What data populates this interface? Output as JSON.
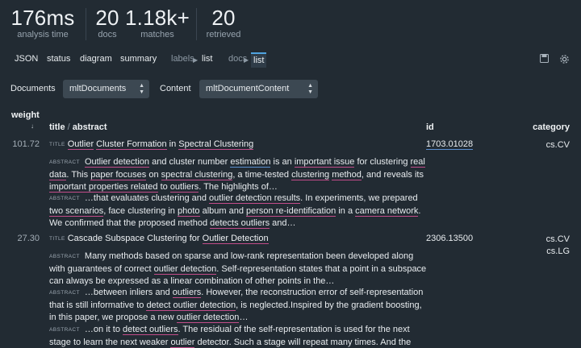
{
  "stats": [
    {
      "value": "176ms",
      "label": "analysis time"
    },
    {
      "value": "20",
      "label": "docs"
    },
    {
      "value": "1.18k+",
      "label": "matches"
    },
    {
      "value": "20",
      "label": "retrieved"
    }
  ],
  "nav": {
    "json": "JSON",
    "status": "status",
    "diagram": "diagram",
    "summary": "summary",
    "labels": "labels",
    "labels_list": "list",
    "docs": "docs",
    "docs_list": "list"
  },
  "toolbar": {
    "documents_label": "Documents",
    "documents_value": "mltDocuments",
    "content_label": "Content",
    "content_value": "mltDocumentContent"
  },
  "table": {
    "headers": {
      "weight": "weight",
      "title": "title",
      "sep": "/",
      "abstract": "abstract",
      "id": "id",
      "category": "category"
    },
    "rows": [
      {
        "weight": "101.72",
        "title_tag": "TITLE",
        "title_parts": [
          "Outlier",
          " ",
          "Cluster Formation",
          " in ",
          "Spectral Clustering"
        ],
        "id": "1703.01028",
        "categories": [
          "cs.CV"
        ],
        "abstract_tag": "ABSTRACT",
        "abstract_html": [
          "<span class='tag'>ABSTRACT</span> <u-p>Outlier detection</u-p> and cluster number <u-b>estimation</u-b> is an <u-p>important issue</u-p> for clustering <u-p>real data</u-p>. This <u-p>paper focuses</u-p> on <u-p>spectral clustering</u-p>, a time-tested <u-p>clustering</u-p> <u-p>method</u-p>, and reveals its <u-p>important properties related</u-p> to <u-p>outliers</u-p>. The highlights of…",
          "<span class='tag'>ABSTRACT</span> …that evaluates clustering and <u-p>outlier detection results</u-p>. In experiments, we prepared <u-p>two scenarios</u-p>, face clustering in <u-p>photo</u-p> album and <u-p>person re-identification</u-p> in a <u-p>camera network</u-p>. We confirmed that the proposed method <u-p>detects outliers</u-p> and…"
        ]
      },
      {
        "weight": "27.30",
        "title_tag": "TITLE",
        "title_parts": [
          "Cascade Subspace Clustering for ",
          "Outlier Detection"
        ],
        "id": "2306.13500",
        "categories": [
          "cs.CV",
          "cs.LG"
        ],
        "abstract_tag": "ABSTRACT",
        "abstract_html": [
          "<span class='tag'>ABSTRACT</span> Many methods based on sparse and low-rank representation been developed along with guarantees of correct <u-p>outlier detection</u-p>. Self-representation states that a point in a subspace can always be expressed as a linear combination of other points in the…",
          "<span class='tag'>ABSTRACT</span> …between inliers and <u-p>outliers</u-p>. However, the reconstruction error of self-representation that is still informative to <u-p>detect outlier detection</u-p>, is neglected.Inspired by the gradient boosting, in this paper, we propose a new <u-p>outlier detection</u-p>…",
          "<span class='tag'>ABSTRACT</span> …on it to <u-p>detect outliers</u-p>. The residual of the self-representation is used for the next stage to learn the next weaker <u-p>outlier</u-p> detector. Such a stage will repeat many times. And the final decision of <u-p>outliers</u-p> is generated by the previous all…"
        ]
      }
    ]
  },
  "colors": {
    "background": "#222b33",
    "underline_pink": "#c24c8a",
    "underline_blue": "#5b8fd0",
    "tab_active": "#4fa3e0"
  },
  "icons": [
    "save-icon",
    "gear-icon",
    "sort-arrow-icon",
    "chevron-updown-icon"
  ]
}
